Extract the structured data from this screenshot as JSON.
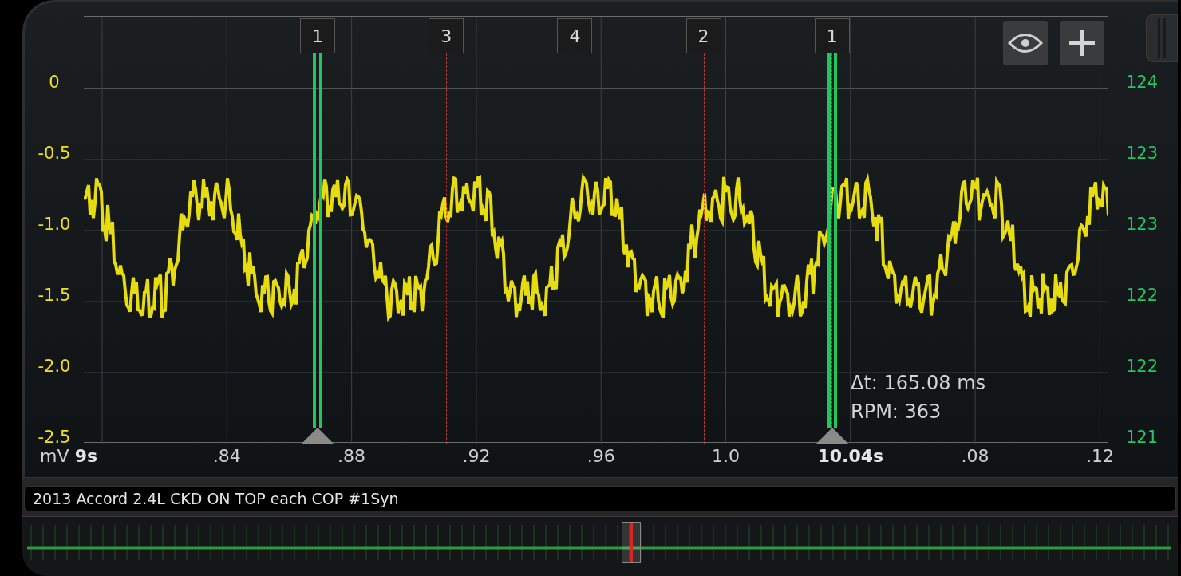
{
  "markers": [
    {
      "label": "1",
      "kind": "cursor"
    },
    {
      "label": "3",
      "kind": "reference"
    },
    {
      "label": "4",
      "kind": "reference"
    },
    {
      "label": "2",
      "kind": "reference"
    },
    {
      "label": "1",
      "kind": "cursor"
    }
  ],
  "left_axis": [
    "0",
    "-0.5",
    "-1.0",
    "-1.5",
    "-2.0",
    "-2.5"
  ],
  "right_axis": [
    "124",
    "123",
    "123",
    "122",
    "122",
    "121"
  ],
  "x_axis": {
    "unit": "mV",
    "labels": [
      {
        "text": "9s",
        "major": true
      },
      {
        "text": ".84",
        "major": false
      },
      {
        "text": ".88",
        "major": false
      },
      {
        "text": ".92",
        "major": false
      },
      {
        "text": ".96",
        "major": false
      },
      {
        "text": "1.0",
        "major": false
      },
      {
        "text": "10.04s",
        "major": true
      },
      {
        "text": ".08",
        "major": false
      },
      {
        "text": ".12",
        "major": false
      }
    ]
  },
  "readout": [
    "Δt: 165.08 ms",
    "RPM: 363"
  ],
  "recording_title": "2013 Accord 2.4L CKD ON TOP each COP #1Syn"
}
